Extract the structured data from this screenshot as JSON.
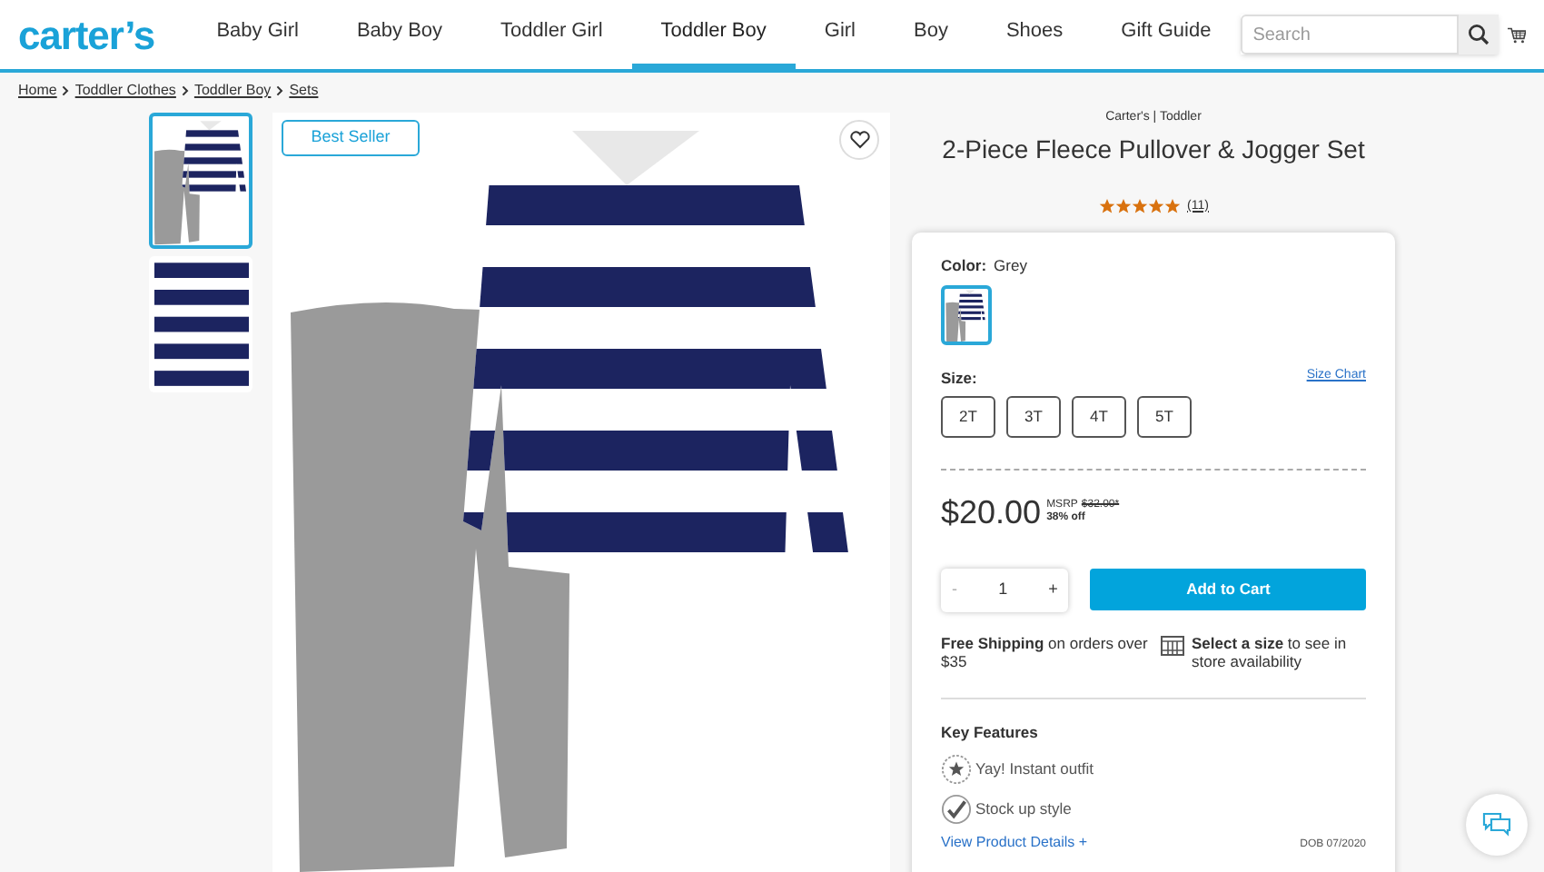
{
  "logo": "carter’s",
  "nav": [
    {
      "label": "Baby Girl",
      "selected": false
    },
    {
      "label": "Baby Boy",
      "selected": false
    },
    {
      "label": "Toddler Girl",
      "selected": false
    },
    {
      "label": "Toddler Boy",
      "selected": true
    },
    {
      "label": "Girl",
      "selected": false
    },
    {
      "label": "Boy",
      "selected": false
    },
    {
      "label": "Shoes",
      "selected": false
    },
    {
      "label": "Gift Guide",
      "selected": false
    }
  ],
  "search": {
    "placeholder": "Search"
  },
  "breadcrumb": [
    "Home",
    "Toddler Clothes",
    "Toddler Boy",
    "Sets"
  ],
  "thumbnails": [
    {
      "kind": "set",
      "selected": true
    },
    {
      "kind": "stripes",
      "selected": false
    }
  ],
  "badge": "Best Seller",
  "product": {
    "brand": "Carter's | Toddler",
    "title": "2-Piece Fleece Pullover & Jogger Set",
    "stars": 5,
    "reviews": "(11)"
  },
  "color": {
    "label": "Color:",
    "value": "Grey",
    "swatches": [
      {
        "selected": true
      }
    ]
  },
  "size": {
    "label": "Size:",
    "chart_link": "Size Chart",
    "options": [
      {
        "label": "2T",
        "selected": false
      },
      {
        "label": "3T",
        "selected": false
      },
      {
        "label": "4T",
        "selected": false
      },
      {
        "label": "5T",
        "selected": false
      }
    ]
  },
  "price": {
    "current": "$20.00",
    "msrp_label": "MSRP",
    "msrp": "$32.00*",
    "discount": "38% off"
  },
  "quantity": {
    "minus": "-",
    "value": "1",
    "plus": "+"
  },
  "add_to_cart": "Add to Cart",
  "shipping": "**Free Shipping** on orders over $35",
  "store": "**Select a size** to see in store availability",
  "key_features": {
    "title": "Key Features",
    "items": [
      {
        "kind": "star",
        "text": "Yay! Instant outfit"
      },
      {
        "kind": "check",
        "text": "Stock up style"
      }
    ]
  },
  "details_link": "View Product Details +",
  "dob": "DOB 07/2020"
}
